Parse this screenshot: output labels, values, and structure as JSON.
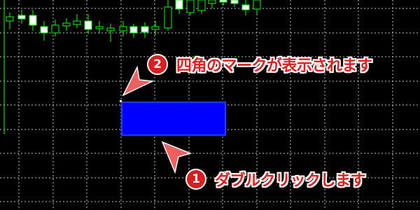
{
  "chart": {
    "background": "#000000",
    "grid_color": "#c0c0c0",
    "candle_up_fill": "#000000",
    "candle_down_fill": "#ffffff",
    "candle_outline": "#00ff00"
  },
  "rectangle_object": {
    "fill": "#0000ff",
    "border": "#1e3cff",
    "anchor_point_color": "#ffffff"
  },
  "callouts": [
    {
      "number": "2",
      "text": "四角のマークが表示されます",
      "color": "#e01f1f",
      "arrow_direction": "down-left"
    },
    {
      "number": "1",
      "text": "ダブルクリックします",
      "color": "#e01f1f",
      "arrow_direction": "up-left"
    }
  ]
}
